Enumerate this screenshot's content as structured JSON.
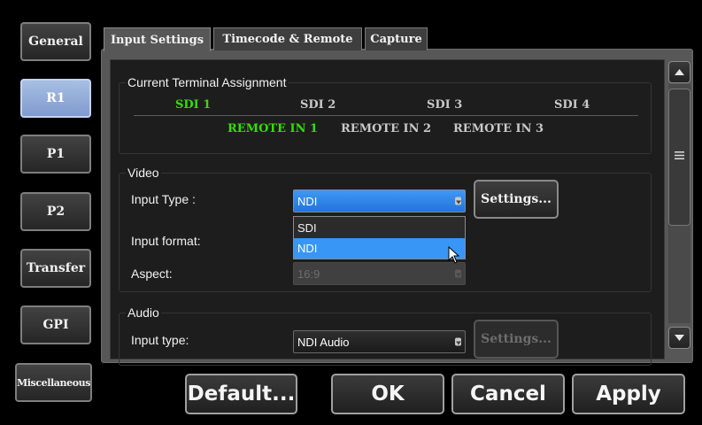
{
  "sidebar": {
    "items": [
      {
        "label": "General"
      },
      {
        "label": "R1"
      },
      {
        "label": "P1"
      },
      {
        "label": "P2"
      },
      {
        "label": "Transfer"
      },
      {
        "label": "GPI"
      },
      {
        "label": "Miscellaneous"
      }
    ],
    "active": "R1"
  },
  "tabs": [
    {
      "label": "Input Settings"
    },
    {
      "label": "Timecode & Remote"
    },
    {
      "label": "Capture"
    }
  ],
  "terminal": {
    "title": "Current Terminal Assignment",
    "sdi": [
      "SDI 1",
      "SDI 2",
      "SDI 3",
      "SDI 4"
    ],
    "remote": [
      "REMOTE IN 1",
      "REMOTE IN 2",
      "REMOTE IN 3"
    ]
  },
  "video": {
    "title": "Video",
    "input_type_label": "Input Type :",
    "input_type_value": "NDI",
    "settings_label": "Settings...",
    "input_format_label": "Input format:",
    "aspect_label": "Aspect:",
    "aspect_value": "16:9",
    "dropdown_options": [
      "SDI",
      "NDI"
    ],
    "dropdown_selected": "NDI"
  },
  "audio": {
    "title": "Audio",
    "input_type_label": "Input type:",
    "input_type_value": "NDI Audio",
    "settings_label": "Settings..."
  },
  "footer": {
    "default_label": "Default...",
    "ok_label": "OK",
    "cancel_label": "Cancel",
    "apply_label": "Apply"
  },
  "colors": {
    "active_green": "#33e000",
    "accent_blue": "#3796f6",
    "sidebar_active": "#8fa9d9"
  },
  "icons": {
    "scroll_up": "triangle-up-icon",
    "scroll_down": "triangle-down-icon",
    "scroll_grip": "grip-lines-icon",
    "cursor": "mouse-pointer-icon"
  }
}
